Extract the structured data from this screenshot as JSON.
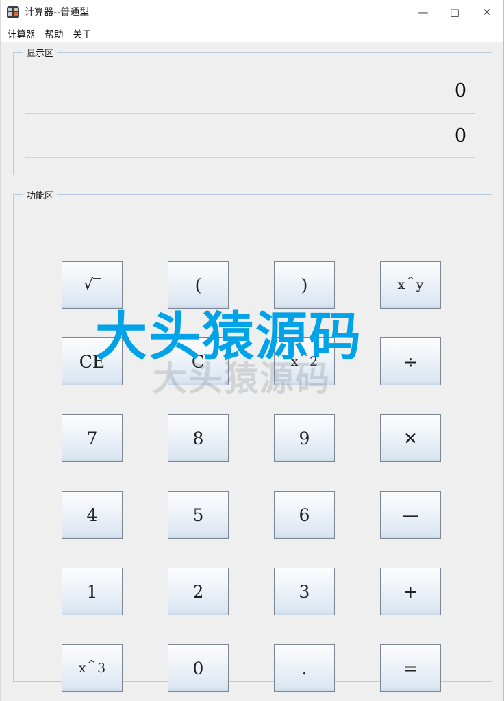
{
  "window": {
    "title": "计算器--普通型",
    "icon": "calculator-icon",
    "controls": {
      "minimize": "—",
      "maximize": "□",
      "close": "✕"
    }
  },
  "menubar": {
    "items": [
      {
        "label": "计算器"
      },
      {
        "label": "帮助"
      },
      {
        "label": "关于"
      }
    ]
  },
  "display": {
    "group_label": "显示区",
    "expression_value": "0",
    "result_value": "0"
  },
  "functions": {
    "group_label": "功能区",
    "keys": [
      {
        "name": "sqrt",
        "label": "√‾",
        "style": "sqrt"
      },
      {
        "name": "paren-open",
        "label": "(",
        "style": "normal"
      },
      {
        "name": "paren-close",
        "label": ")",
        "style": "normal"
      },
      {
        "name": "power-y",
        "label": "x ^ y",
        "style": "power",
        "base": "x",
        "exp": "y"
      },
      {
        "name": "clear-entry",
        "label": "CE",
        "style": "normal"
      },
      {
        "name": "clear",
        "label": "C",
        "style": "normal"
      },
      {
        "name": "power-2",
        "label": "x ^ 2",
        "style": "power",
        "base": "x",
        "exp": "2"
      },
      {
        "name": "divide",
        "label": "÷",
        "style": "normal"
      },
      {
        "name": "digit-7",
        "label": "7",
        "style": "normal"
      },
      {
        "name": "digit-8",
        "label": "8",
        "style": "normal"
      },
      {
        "name": "digit-9",
        "label": "9",
        "style": "normal"
      },
      {
        "name": "multiply",
        "label": "✕",
        "style": "normal"
      },
      {
        "name": "digit-4",
        "label": "4",
        "style": "normal"
      },
      {
        "name": "digit-5",
        "label": "5",
        "style": "normal"
      },
      {
        "name": "digit-6",
        "label": "6",
        "style": "normal"
      },
      {
        "name": "subtract",
        "label": "—",
        "style": "normal"
      },
      {
        "name": "digit-1",
        "label": "1",
        "style": "normal"
      },
      {
        "name": "digit-2",
        "label": "2",
        "style": "normal"
      },
      {
        "name": "digit-3",
        "label": "3",
        "style": "normal"
      },
      {
        "name": "add",
        "label": "+",
        "style": "normal"
      },
      {
        "name": "power-3",
        "label": "x ^ 3",
        "style": "power",
        "base": "x",
        "exp": "3"
      },
      {
        "name": "digit-0",
        "label": "0",
        "style": "normal"
      },
      {
        "name": "decimal",
        "label": ".",
        "style": "normal"
      },
      {
        "name": "equals",
        "label": "=",
        "style": "normal"
      }
    ]
  },
  "watermarks": {
    "primary": "大头猿源码",
    "secondary": "大头猿源码"
  },
  "colors": {
    "watermark_blue": "#00a2e8",
    "groupbox_border": "#b8cbdf",
    "window_background": "#efefef",
    "key_border": "#7d8794",
    "icon_accent": "#e8622a"
  }
}
